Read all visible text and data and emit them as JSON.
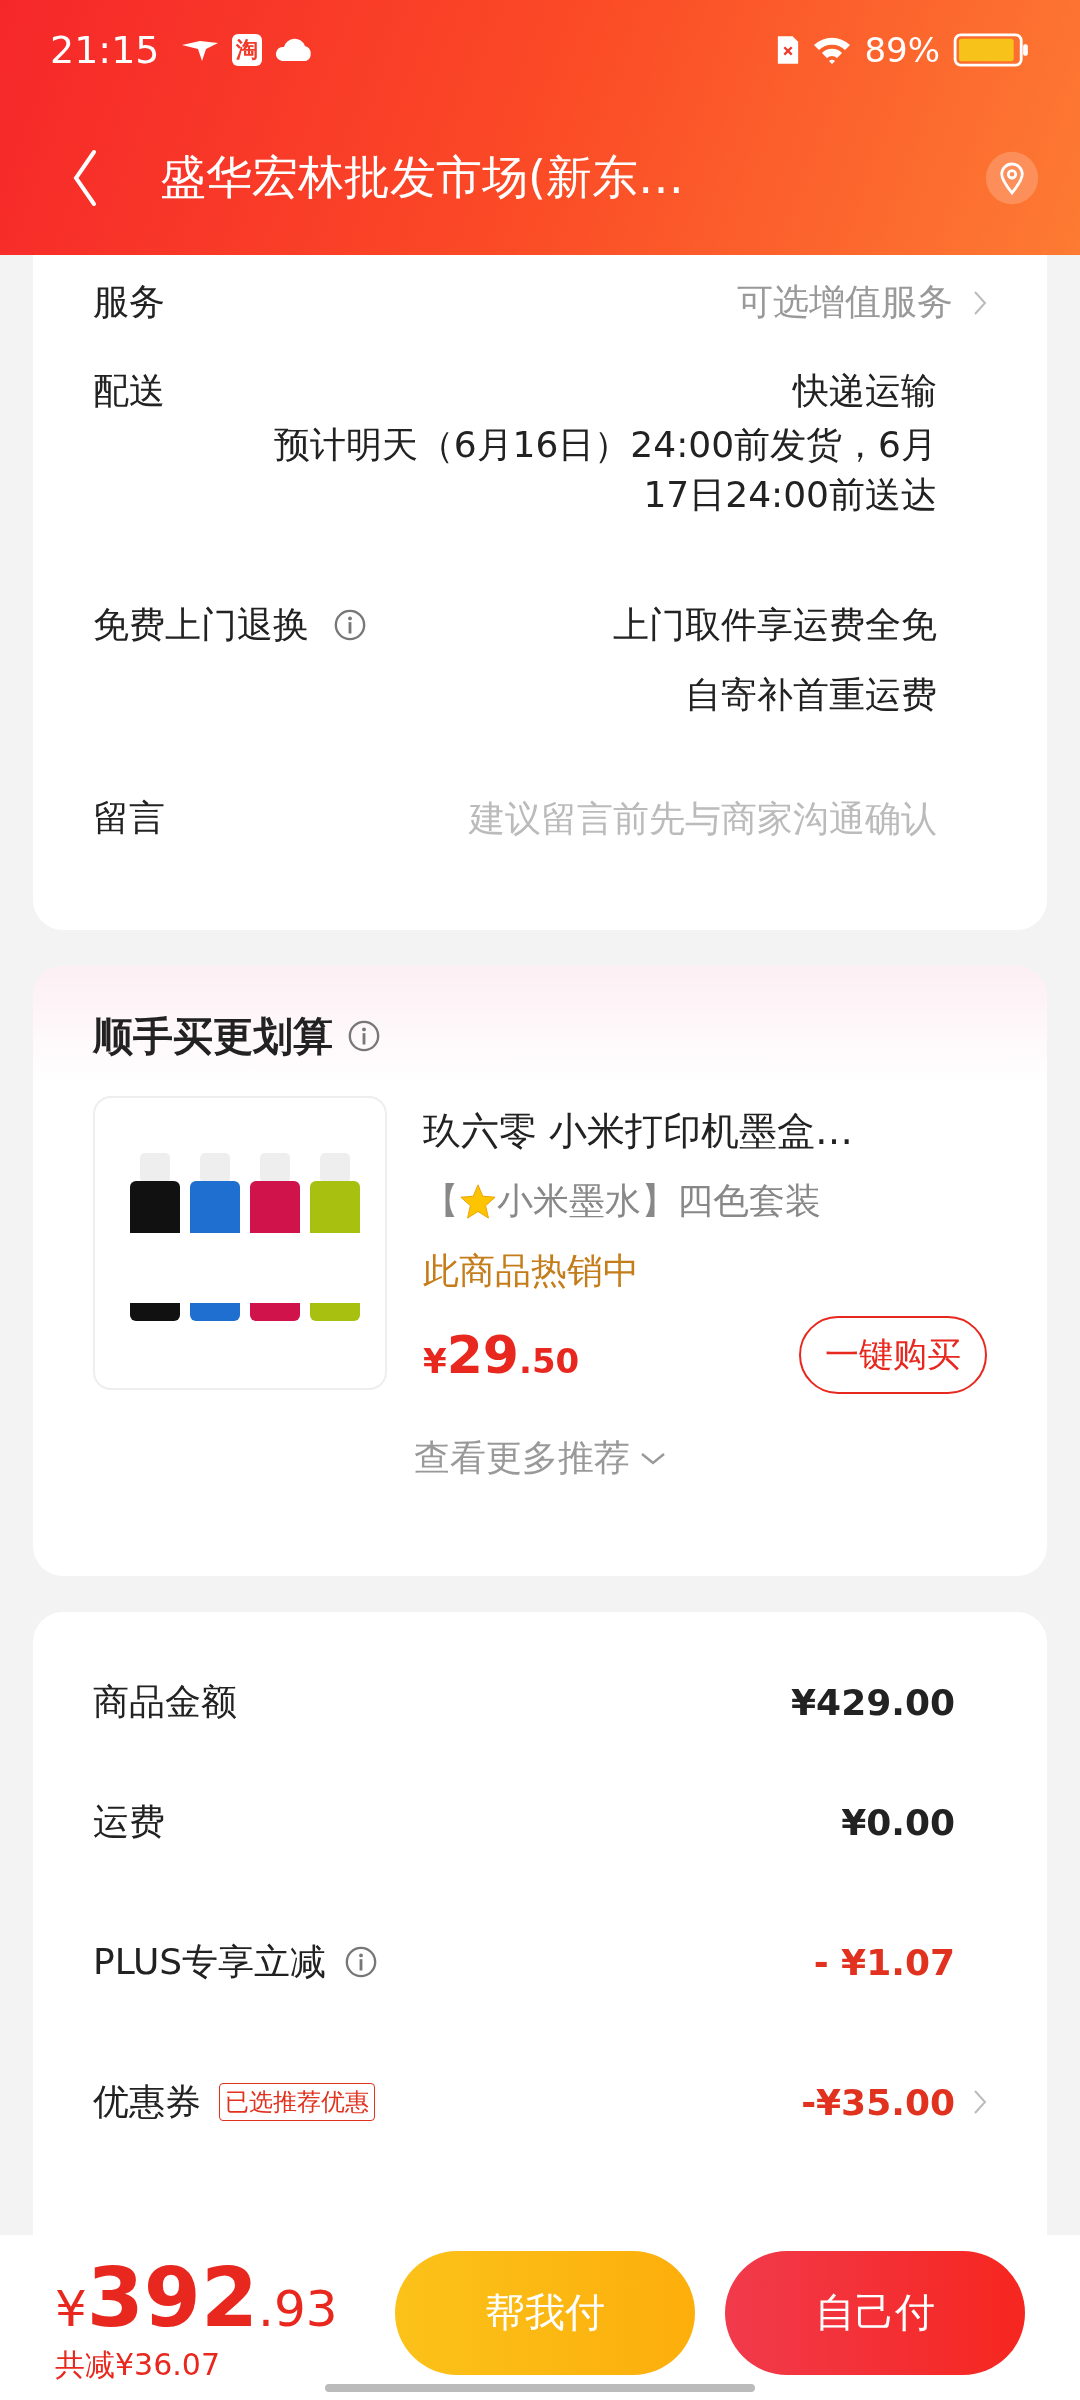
{
  "status_bar": {
    "time": "21:15",
    "app_badge": "淘",
    "battery": "89%"
  },
  "header": {
    "title": "盛华宏林批发市场(新东…"
  },
  "order_rows": [
    {
      "kind": "link",
      "label": "服务",
      "value": "可选增值服务"
    },
    {
      "kind": "delivery",
      "label": "配送",
      "value": "快递运输",
      "detail": [
        "预计明天（6月16日）24:00前发货，6月",
        "17日24:00前送达"
      ]
    },
    {
      "kind": "return",
      "label": "免费上门退换",
      "lines": [
        "上门取件享运费全免",
        "自寄补首重运费"
      ]
    },
    {
      "kind": "message",
      "label": "留言",
      "placeholder": "建议留言前先与商家沟通确认"
    }
  ],
  "recommend": {
    "title": "顺手买更划算",
    "product": {
      "kind": "picture",
      "name": "玖六零 小米打印机墨盒…",
      "spec_open": "【",
      "spec": "小米墨水】四色套装",
      "hot": "此商品热销中",
      "currency": "¥",
      "price_int": "29",
      "price_dec": ".50",
      "button": "一键购买"
    },
    "more": "查看更多推荐"
  },
  "summary": [
    {
      "kind": "plain",
      "label": "商品金额",
      "value": "¥429.00"
    },
    {
      "kind": "plain",
      "label": "运费",
      "value": "¥0.00"
    },
    {
      "kind": "discount",
      "label": "PLUS专享立减",
      "info": true,
      "value": "- ¥1.07"
    },
    {
      "kind": "coupon",
      "label": "优惠券",
      "tag": "已选推荐优惠",
      "value": "-¥35.00"
    }
  ],
  "bottom_bar": {
    "currency": "¥",
    "total_int": "392",
    "total_dec": ".93",
    "saved": "共减¥36.07",
    "buttons": [
      {
        "kind": "secondary",
        "label": "帮我付"
      },
      {
        "kind": "primary",
        "label": "自己付"
      }
    ]
  }
}
